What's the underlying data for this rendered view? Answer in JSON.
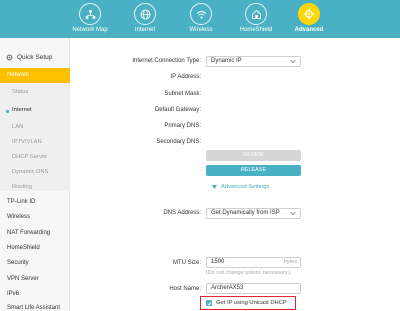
{
  "topnav": {
    "items": [
      {
        "label": "Network Map",
        "icon": "network-map-icon"
      },
      {
        "label": "Internet",
        "icon": "globe-icon"
      },
      {
        "label": "Wireless",
        "icon": "wifi-icon"
      },
      {
        "label": "HomeShield",
        "icon": "home-shield-icon"
      },
      {
        "label": "Advanced",
        "icon": "gear-icon"
      }
    ],
    "active_index": 4,
    "colors": {
      "bar": "#4ab1c4",
      "active": "#ffd60a"
    }
  },
  "sidebar": {
    "quick_setup": "Quick Setup",
    "active_section": "Network",
    "sub_items": [
      "Status",
      "Internet",
      "LAN",
      "IPTV/VLAN",
      "DHCP Server",
      "Dynamic DNS",
      "Routing"
    ],
    "current_sub": "Internet",
    "items": [
      "TP-Link ID",
      "Wireless",
      "NAT Forwarding",
      "HomeShield",
      "Security",
      "VPN Server",
      "IPv6",
      "Smart Life Assistant"
    ],
    "accent": "#ffc000"
  },
  "form": {
    "connection_type_label": "Internet Connection Type:",
    "connection_type_value": "Dynamic IP",
    "ip_label": "IP Address:",
    "subnet_label": "Subnet Mask:",
    "gateway_label": "Default Gateway:",
    "primary_dns_label": "Primary DNS:",
    "secondary_dns_label": "Secondary DNS:",
    "renew_label": "RENEW",
    "release_label": "RELEASE",
    "advanced_link": "Advanced Settings",
    "dns_label": "DNS Address:",
    "dns_value": "Get Dynamically from ISP",
    "mtu_label": "MTU Size:",
    "mtu_value": "1500",
    "mtu_unit": "bytes",
    "mtu_hint": "(Do not change unless necessary.)",
    "host_label": "Host Name:",
    "host_value": "ArcherAX53",
    "unicast_label": "Get IP using Unicast DHCP",
    "unicast_checked": true
  }
}
